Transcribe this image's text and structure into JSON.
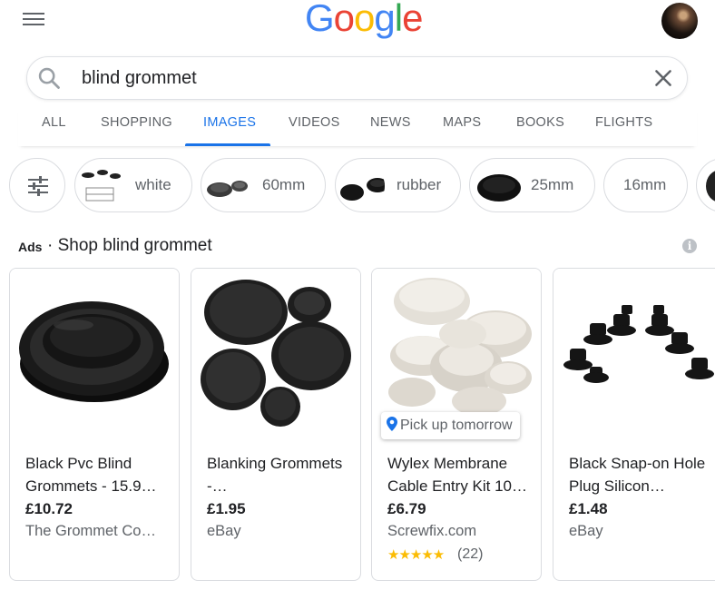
{
  "header": {
    "logo_letters": [
      "G",
      "o",
      "o",
      "g",
      "l",
      "e"
    ],
    "logo_colors": [
      "#4285F4",
      "#EA4335",
      "#FBBC05",
      "#4285F4",
      "#34A853",
      "#EA4335"
    ]
  },
  "search": {
    "value": "blind grommet",
    "placeholder": ""
  },
  "tabs": [
    "ALL",
    "SHOPPING",
    "IMAGES",
    "VIDEOS",
    "NEWS",
    "MAPS",
    "BOOKS",
    "FLIGHTS"
  ],
  "active_tab": "IMAGES",
  "chips": [
    "white",
    "60mm",
    "rubber",
    "25mm",
    "16mm"
  ],
  "ads": {
    "label": "Ads",
    "title": "· Shop blind grommet"
  },
  "products": [
    {
      "title": "Black Pvc Blind Grommets - 15.9…",
      "price": "£10.72",
      "store": "The Grommet Co…"
    },
    {
      "title": "Blanking Grommets -…",
      "price": "£1.95",
      "store": "eBay"
    },
    {
      "title": "Wylex Membrane Cable Entry Kit 10…",
      "price": "£6.79",
      "store": "Screwfix.com",
      "badge": "Pick up tomorrow",
      "stars": "★★★★★",
      "reviews": "(22)"
    },
    {
      "title": "Black Snap-on Hole Plug Silicon…",
      "price": "£1.48",
      "store": "eBay"
    }
  ],
  "colors": {
    "accent": "#1a73e8",
    "star": "#fbbc04",
    "text_secondary": "#5f6368"
  }
}
